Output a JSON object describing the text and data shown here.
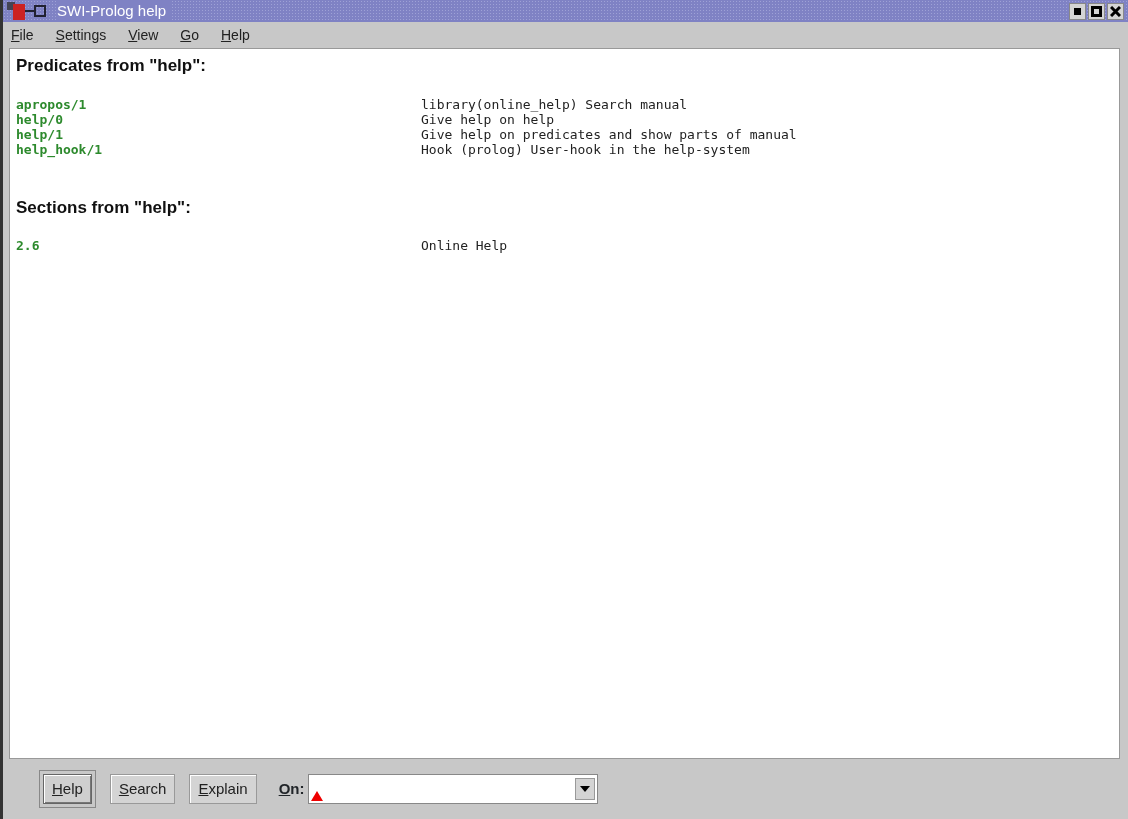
{
  "window": {
    "title": "SWI-Prolog help"
  },
  "menu": [
    {
      "label": "File"
    },
    {
      "label": "Settings"
    },
    {
      "label": "View"
    },
    {
      "label": "Go"
    },
    {
      "label": "Help"
    }
  ],
  "sections": [
    {
      "heading": "Predicates from \"help\":",
      "entries": [
        {
          "name": "apropos/1",
          "description": "library(online_help) Search manual"
        },
        {
          "name": "help/0",
          "description": "Give help on help"
        },
        {
          "name": "help/1",
          "description": "Give help on predicates and show parts of manual"
        },
        {
          "name": "help_hook/1",
          "description": "Hook (prolog) User-hook in the help-system"
        }
      ]
    },
    {
      "heading": "Sections from \"help\":",
      "entries": [
        {
          "name": "2.6",
          "description": "Online Help"
        }
      ]
    }
  ],
  "buttons": [
    {
      "label": "Help",
      "selected": true
    },
    {
      "label": "Search",
      "selected": false
    },
    {
      "label": "Explain",
      "selected": false
    }
  ],
  "on_field": {
    "label": "On:"
  }
}
